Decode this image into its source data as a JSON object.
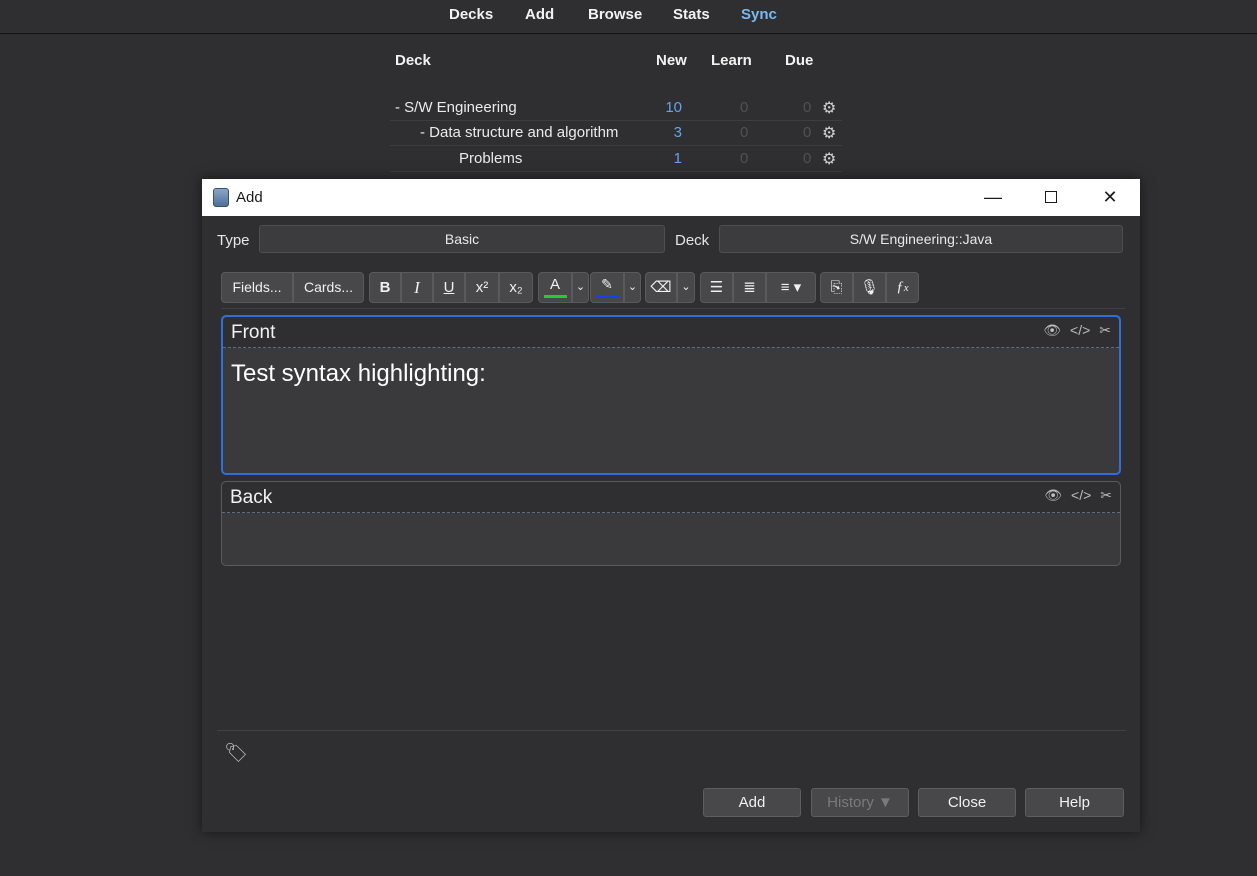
{
  "topnav": {
    "items": [
      "Decks",
      "Add",
      "Browse",
      "Stats",
      "Sync"
    ]
  },
  "decklist": {
    "headers": {
      "deck": "Deck",
      "new": "New",
      "learn": "Learn",
      "due": "Due"
    },
    "rows": [
      {
        "name": "-  S/W Engineering",
        "new": "10",
        "learn": "0",
        "due": "0"
      },
      {
        "name": "-  Data structure and algorithm",
        "new": "3",
        "learn": "0",
        "due": "0"
      },
      {
        "name": "Problems",
        "new": "1",
        "learn": "0",
        "due": "0"
      }
    ]
  },
  "dialog": {
    "title": "Add",
    "type_label": "Type",
    "type_value": "Basic",
    "deck_label": "Deck",
    "deck_value": "S/W Engineering::Java",
    "toolbar": {
      "fields": "Fields...",
      "cards": "Cards...",
      "bold": "B",
      "italic": "I",
      "underline": "U",
      "superscript": "x²",
      "subscript": "x₂",
      "text_color": "A",
      "text_color_hex": "#1fcf2e",
      "highlight_color_hex": "#1b3cf2"
    },
    "fields": [
      {
        "name": "Front",
        "value": "Test syntax highlighting:"
      },
      {
        "name": "Back",
        "value": ""
      }
    ],
    "buttons": {
      "add": "Add",
      "history": "History ▼",
      "close": "Close",
      "help": "Help"
    }
  }
}
